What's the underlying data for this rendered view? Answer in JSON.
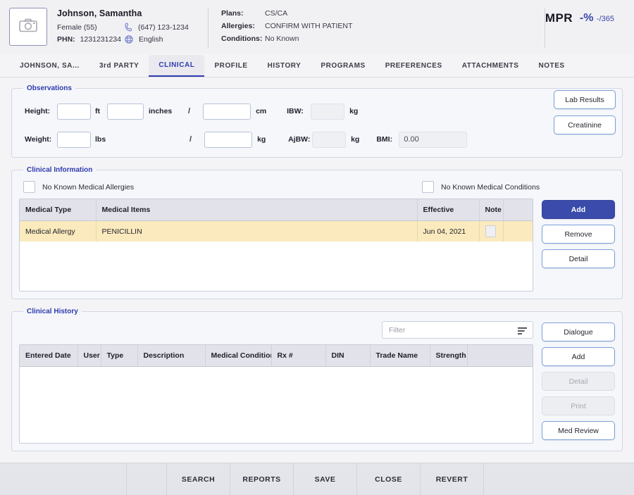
{
  "patient": {
    "photo_icon": "camera-icon",
    "name": "Johnson, Samantha",
    "sex_age": "Female (55)",
    "phone_icon": "phone-icon",
    "phone": "(647) 123-1234",
    "phn_label": "PHN:",
    "phn_value": "1231231234",
    "language_icon": "globe-icon",
    "language": "English",
    "plans_label": "Plans:",
    "plans_value": "CS/CA",
    "allergies_label": "Allergies:",
    "allergies_value": "CONFIRM WITH PATIENT",
    "conditions_label": "Conditions:",
    "conditions_value": "No Known"
  },
  "mpr": {
    "label": "MPR",
    "percent": "-%",
    "denominator": "-/365",
    "color": "#3b47a8"
  },
  "tabs": [
    {
      "label": "JOHNSON, SA...",
      "active": false
    },
    {
      "label": "3rd PARTY",
      "active": false
    },
    {
      "label": "CLINICAL",
      "active": true
    },
    {
      "label": "PROFILE",
      "active": false
    },
    {
      "label": "HISTORY",
      "active": false
    },
    {
      "label": "PROGRAMS",
      "active": false
    },
    {
      "label": "PREFERENCES",
      "active": false
    },
    {
      "label": "ATTACHMENTS",
      "active": false
    },
    {
      "label": "NOTES",
      "active": false
    }
  ],
  "observations": {
    "legend": "Observations",
    "height_label": "Height:",
    "height_ft_value": "",
    "unit_ft": "ft",
    "height_in_value": "",
    "unit_inches": "inches",
    "slash": "/",
    "height_cm_value": "",
    "unit_cm": "cm",
    "ibw_label": "IBW:",
    "ibw_value": "",
    "ibw_unit": "kg",
    "weight_label": "Weight:",
    "weight_lbs_value": "",
    "unit_lbs": "lbs",
    "weight_kg_value": "",
    "weight_kg_unit": "kg",
    "ajbw_label": "AjBW:",
    "ajbw_value": "",
    "ajbw_unit": "kg",
    "bmi_label": "BMI:",
    "bmi_value": "0.00",
    "lab_results_button": "Lab Results",
    "creatinine_button": "Creatinine"
  },
  "clinical_information": {
    "legend": "Clinical Information",
    "no_known_allergies_label": "No Known Medical Allergies",
    "no_known_allergies_checked": false,
    "no_known_conditions_label": "No Known Medical Conditions",
    "no_known_conditions_checked": false,
    "columns": [
      "Medical Type",
      "Medical Items",
      "Effective",
      "Note",
      ""
    ],
    "rows": [
      {
        "medical_type": "Medical Allergy",
        "medical_items": "PENICILLIN",
        "effective": "Jun 04, 2021",
        "note": "",
        "highlighted": true
      }
    ],
    "buttons": [
      {
        "label": "Add",
        "style": "primary",
        "disabled": false
      },
      {
        "label": "Remove",
        "style": "outline",
        "disabled": false
      },
      {
        "label": "Detail",
        "style": "outline",
        "disabled": false
      }
    ]
  },
  "clinical_history": {
    "legend": "Clinical History",
    "filter_placeholder": "Filter",
    "filter_value": "",
    "filter_icon": "filter-icon",
    "columns": [
      "Entered Date",
      "User",
      "Type",
      "Description",
      "Medical Condition",
      "Rx #",
      "DIN",
      "Trade Name",
      "Strength",
      ""
    ],
    "rows": [],
    "buttons": [
      {
        "label": "Dialogue",
        "style": "outline",
        "disabled": false
      },
      {
        "label": "Add",
        "style": "outline",
        "disabled": false
      },
      {
        "label": "Detail",
        "style": "outline",
        "disabled": true
      },
      {
        "label": "Print",
        "style": "outline",
        "disabled": true
      },
      {
        "label": "Med Review",
        "style": "outline",
        "disabled": false
      }
    ]
  },
  "bottom_bar": {
    "buttons": [
      "SEARCH",
      "REPORTS",
      "SAVE",
      "CLOSE",
      "REVERT"
    ]
  }
}
